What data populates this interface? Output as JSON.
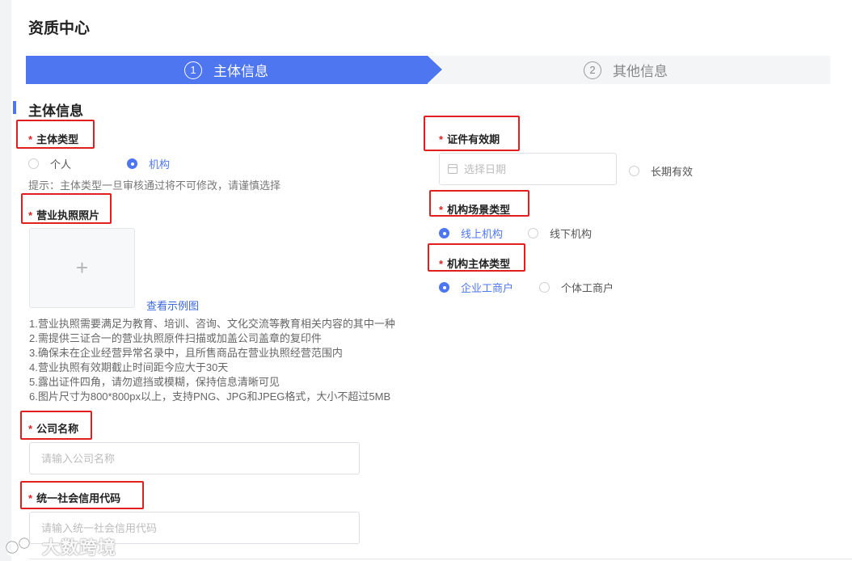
{
  "page": {
    "title": "资质中心"
  },
  "steps": [
    {
      "num": "1",
      "label": "主体信息"
    },
    {
      "num": "2",
      "label": "其他信息"
    }
  ],
  "section": {
    "title": "主体信息"
  },
  "required_star": "*",
  "subject_type": {
    "label": "主体类型",
    "options": [
      "个人",
      "机构"
    ],
    "selected": "机构",
    "hint": "提示：主体类型一旦审核通过将不可修改，请谨慎选择"
  },
  "license_photo": {
    "label": "营业执照照片",
    "upload_symbol": "+",
    "example_link": "查看示例图",
    "requirements": [
      "1.营业执照需要满足为教育、培训、咨询、文化交流等教育相关内容的其中一种",
      "2.需提供三证合一的营业执照原件扫描或加盖公司盖章的复印件",
      "3.确保未在企业经营异常名录中，且所售商品在营业执照经营范围内",
      "4.营业执照有效期截止时间距今应大于30天",
      "5.露出证件四角，请勿遮挡或模糊，保持信息清晰可见",
      "6.图片尺寸为800*800px以上，支持PNG、JPG和JPEG格式，大小不超过5MB"
    ]
  },
  "company_name": {
    "label": "公司名称",
    "placeholder": "请输入公司名称",
    "value": ""
  },
  "credit_code": {
    "label": "统一社会信用代码",
    "placeholder": "请输入统一社会信用代码",
    "value": ""
  },
  "validity": {
    "label": "证件有效期",
    "placeholder": "选择日期",
    "long_term": "长期有效"
  },
  "scene_type": {
    "label": "机构场景类型",
    "options": [
      "线上机构",
      "线下机构"
    ],
    "selected": "线上机构"
  },
  "org_subject_type": {
    "label": "机构主体类型",
    "options": [
      "企业工商户",
      "个体工商户"
    ],
    "selected": "企业工商户"
  },
  "watermark": {
    "text": "大数跨境"
  },
  "colors": {
    "primary": "#4e76f0",
    "required": "#e02020",
    "highlight_box": "#e02020"
  }
}
